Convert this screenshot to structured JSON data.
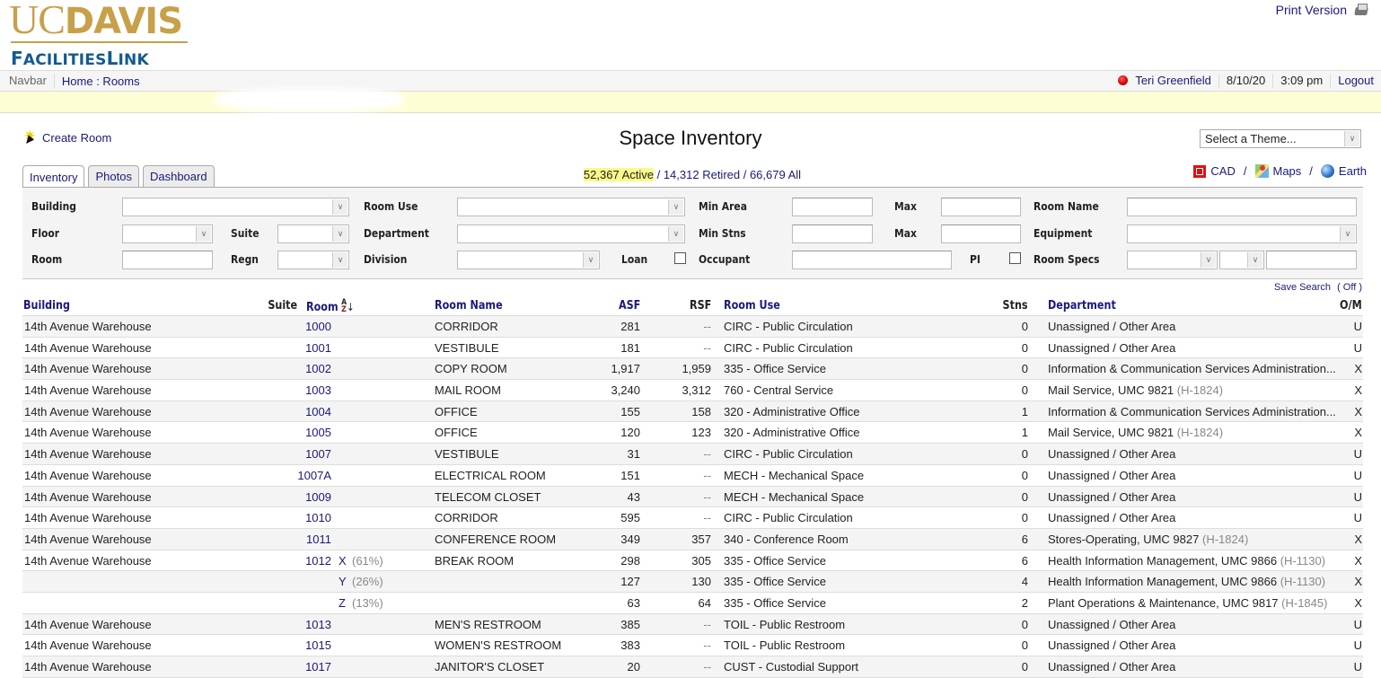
{
  "header": {
    "logo_uc": "UC",
    "logo_davis": "DAVIS",
    "logo_facilities": "FACILITIESLINK",
    "print_version": "Print Version",
    "print_icon": "printer-icon"
  },
  "navbar": {
    "label": "Navbar",
    "breadcrumb": "Home : Rooms",
    "status_icon": "red-status-dot",
    "user": "Teri Greenfield",
    "date": "8/10/20",
    "time": "3:09 pm",
    "logout": "Logout"
  },
  "page": {
    "title": "Space Inventory",
    "create_room": "Create Room",
    "theme_select": "Select a Theme...",
    "counts": {
      "active": "52,367 Active",
      "sep1": " / ",
      "retired": "14,312 Retired",
      "sep2": " / ",
      "all": "66,679 All"
    },
    "tabs": [
      "Inventory",
      "Photos",
      "Dashboard"
    ],
    "active_tab": "Inventory",
    "map_links": {
      "cad": "CAD",
      "maps": "Maps",
      "earth": "Earth",
      "sep": "/"
    }
  },
  "filters": {
    "building": "Building",
    "room_use": "Room Use",
    "min_area": "Min Area",
    "max_area": "Max",
    "room_name": "Room Name",
    "floor": "Floor",
    "suite": "Suite",
    "department": "Department",
    "min_stns": "Min Stns",
    "max_stns": "Max",
    "equipment": "Equipment",
    "room": "Room",
    "regn": "Regn",
    "division": "Division",
    "loan": "Loan",
    "occupant": "Occupant",
    "pi": "PI",
    "room_specs": "Room Specs",
    "values": {
      "building": "",
      "room_use": "",
      "min_area": "",
      "max_area": "",
      "room_name": "",
      "floor": "",
      "suite": "",
      "department": "",
      "min_stns": "",
      "max_stns": "",
      "equipment": "",
      "room": "",
      "regn": "",
      "division": "",
      "loan": false,
      "occupant": "",
      "pi": false,
      "room_specs_1": "",
      "room_specs_2": "",
      "room_specs_3": ""
    }
  },
  "table": {
    "save_search": "Save Search",
    "save_search_state": "( Off )",
    "columns": {
      "building": "Building",
      "suite": "Suite",
      "room": "Room",
      "room_name": "Room Name",
      "asf": "ASF",
      "rsf": "RSF",
      "room_use": "Room Use",
      "stns": "Stns",
      "department": "Department",
      "om": "O/M"
    },
    "sort": "room-ascending",
    "rows": [
      {
        "building": "14th Avenue Warehouse",
        "suite": "",
        "room": "1000",
        "split": "",
        "split_pct": "",
        "room_name": "CORRIDOR",
        "asf": "281",
        "rsf": "--",
        "room_use": "CIRC - Public Circulation",
        "stns": "0",
        "department": "Unassigned / Other Area",
        "dept_code": "",
        "om": "U"
      },
      {
        "building": "14th Avenue Warehouse",
        "suite": "",
        "room": "1001",
        "split": "",
        "split_pct": "",
        "room_name": "VESTIBULE",
        "asf": "181",
        "rsf": "--",
        "room_use": "CIRC - Public Circulation",
        "stns": "0",
        "department": "Unassigned / Other Area",
        "dept_code": "",
        "om": "U"
      },
      {
        "building": "14th Avenue Warehouse",
        "suite": "",
        "room": "1002",
        "split": "",
        "split_pct": "",
        "room_name": "COPY ROOM",
        "asf": "1,917",
        "rsf": "1,959",
        "room_use": "335 - Office Service",
        "stns": "0",
        "department": "Information & Communication Services Administration...",
        "dept_code": "",
        "om": "X"
      },
      {
        "building": "14th Avenue Warehouse",
        "suite": "",
        "room": "1003",
        "split": "",
        "split_pct": "",
        "room_name": "MAIL ROOM",
        "asf": "3,240",
        "rsf": "3,312",
        "room_use": "760 - Central Service",
        "stns": "0",
        "department": "Mail Service, UMC 9821",
        "dept_code": "(H-1824)",
        "om": "X"
      },
      {
        "building": "14th Avenue Warehouse",
        "suite": "",
        "room": "1004",
        "split": "",
        "split_pct": "",
        "room_name": "OFFICE",
        "asf": "155",
        "rsf": "158",
        "room_use": "320 - Administrative Office",
        "stns": "1",
        "department": "Information & Communication Services Administration...",
        "dept_code": "",
        "om": "X"
      },
      {
        "building": "14th Avenue Warehouse",
        "suite": "",
        "room": "1005",
        "split": "",
        "split_pct": "",
        "room_name": "OFFICE",
        "asf": "120",
        "rsf": "123",
        "room_use": "320 - Administrative Office",
        "stns": "1",
        "department": "Mail Service, UMC 9821",
        "dept_code": "(H-1824)",
        "om": "X"
      },
      {
        "building": "14th Avenue Warehouse",
        "suite": "",
        "room": "1007",
        "split": "",
        "split_pct": "",
        "room_name": "VESTIBULE",
        "asf": "31",
        "rsf": "--",
        "room_use": "CIRC - Public Circulation",
        "stns": "0",
        "department": "Unassigned / Other Area",
        "dept_code": "",
        "om": "U"
      },
      {
        "building": "14th Avenue Warehouse",
        "suite": "",
        "room": "1007A",
        "split": "",
        "split_pct": "",
        "room_name": "ELECTRICAL ROOM",
        "asf": "151",
        "rsf": "--",
        "room_use": "MECH - Mechanical Space",
        "stns": "0",
        "department": "Unassigned / Other Area",
        "dept_code": "",
        "om": "U"
      },
      {
        "building": "14th Avenue Warehouse",
        "suite": "",
        "room": "1009",
        "split": "",
        "split_pct": "",
        "room_name": "TELECOM CLOSET",
        "asf": "43",
        "rsf": "--",
        "room_use": "MECH - Mechanical Space",
        "stns": "0",
        "department": "Unassigned / Other Area",
        "dept_code": "",
        "om": "U"
      },
      {
        "building": "14th Avenue Warehouse",
        "suite": "",
        "room": "1010",
        "split": "",
        "split_pct": "",
        "room_name": "CORRIDOR",
        "asf": "595",
        "rsf": "--",
        "room_use": "CIRC - Public Circulation",
        "stns": "0",
        "department": "Unassigned / Other Area",
        "dept_code": "",
        "om": "U"
      },
      {
        "building": "14th Avenue Warehouse",
        "suite": "",
        "room": "1011",
        "split": "",
        "split_pct": "",
        "room_name": "CONFERENCE ROOM",
        "asf": "349",
        "rsf": "357",
        "room_use": "340 - Conference Room",
        "stns": "6",
        "department": "Stores-Operating, UMC 9827",
        "dept_code": "(H-1824)",
        "om": "X"
      },
      {
        "building": "14th Avenue Warehouse",
        "suite": "",
        "room": "1012",
        "split": "X",
        "split_pct": "(61%)",
        "room_name": "BREAK ROOM",
        "asf": "298",
        "rsf": "305",
        "room_use": "335 - Office Service",
        "stns": "6",
        "department": "Health Information Management, UMC 9866",
        "dept_code": "(H-1130)",
        "om": "X"
      },
      {
        "building": "",
        "suite": "",
        "room": "",
        "split": "Y",
        "split_pct": "(26%)",
        "room_name": "",
        "asf": "127",
        "rsf": "130",
        "room_use": "335 - Office Service",
        "stns": "4",
        "department": "Health Information Management, UMC 9866",
        "dept_code": "(H-1130)",
        "om": "X"
      },
      {
        "building": "",
        "suite": "",
        "room": "",
        "split": "Z",
        "split_pct": "(13%)",
        "room_name": "",
        "asf": "63",
        "rsf": "64",
        "room_use": "335 - Office Service",
        "stns": "2",
        "department": "Plant Operations & Maintenance, UMC 9817",
        "dept_code": "(H-1845)",
        "om": "X"
      },
      {
        "building": "14th Avenue Warehouse",
        "suite": "",
        "room": "1013",
        "split": "",
        "split_pct": "",
        "room_name": "MEN'S RESTROOM",
        "asf": "385",
        "rsf": "--",
        "room_use": "TOIL - Public Restroom",
        "stns": "0",
        "department": "Unassigned / Other Area",
        "dept_code": "",
        "om": "U"
      },
      {
        "building": "14th Avenue Warehouse",
        "suite": "",
        "room": "1015",
        "split": "",
        "split_pct": "",
        "room_name": "WOMEN'S RESTROOM",
        "asf": "383",
        "rsf": "--",
        "room_use": "TOIL - Public Restroom",
        "stns": "0",
        "department": "Unassigned / Other Area",
        "dept_code": "",
        "om": "U"
      },
      {
        "building": "14th Avenue Warehouse",
        "suite": "",
        "room": "1017",
        "split": "",
        "split_pct": "",
        "room_name": "JANITOR'S CLOSET",
        "asf": "20",
        "rsf": "--",
        "room_use": "CUST - Custodial Support",
        "stns": "0",
        "department": "Unassigned / Other Area",
        "dept_code": "",
        "om": "U"
      }
    ]
  }
}
